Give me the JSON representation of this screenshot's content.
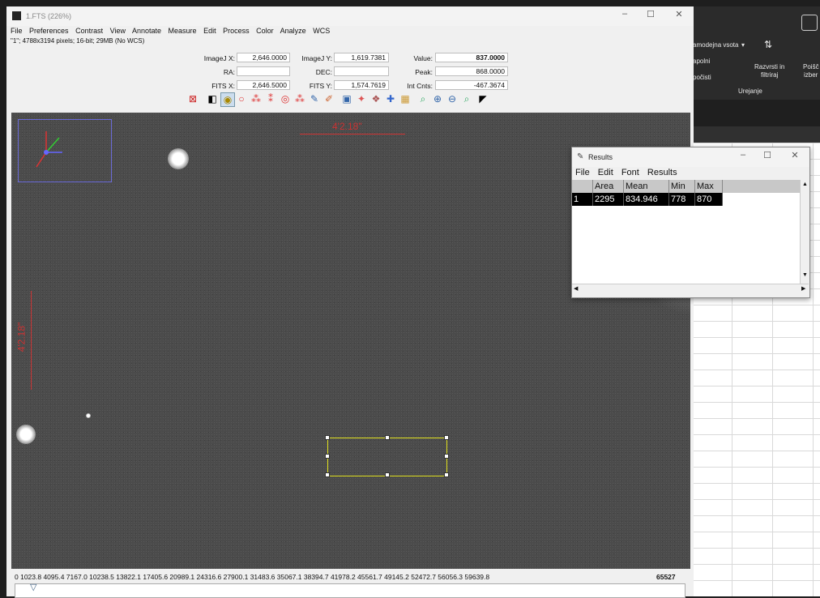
{
  "imagej_window": {
    "title": "1.FTS (226%)",
    "menu": [
      "File",
      "Preferences",
      "Contrast",
      "View",
      "Annotate",
      "Measure",
      "Edit",
      "Process",
      "Color",
      "Analyze",
      "WCS"
    ],
    "info": "\"1\"; 4788x3194 pixels; 16-bit; 29MB (No WCS)",
    "fields": {
      "imagej_x_label": "ImageJ X:",
      "imagej_x": "2,646.0000",
      "imagej_y_label": "ImageJ Y:",
      "imagej_y": "1,619.7381",
      "value_label": "Value:",
      "value": "837.0000",
      "ra_label": "RA:",
      "ra": "",
      "dec_label": "DEC:",
      "dec": "",
      "peak_label": "Peak:",
      "peak": "868.0000",
      "fits_x_label": "FITS X:",
      "fits_x": "2,646.5000",
      "fits_y_label": "FITS Y:",
      "fits_y": "1,574.7619",
      "int_cnts_label": "Int Cnts:",
      "int_cnts": "-467.3674"
    },
    "scale_label_h": "4'2.18\"",
    "scale_label_v": "4'2.18\"",
    "colorbar_ticks": "0  1023.8  4095.4  7167.0  10238.5  13822.1  17405.6  20989.1  24316.6  27900.1  31483.6  35067.1  38394.7  41978.2  45561.7  49145.2  52472.7  56056.3  59639.8",
    "colorbar_max": "65527"
  },
  "results_window": {
    "title": "Results",
    "menu": [
      "File",
      "Edit",
      "Font",
      "Results"
    ],
    "columns": [
      "",
      "Area",
      "Mean",
      "Min",
      "Max"
    ],
    "rows": [
      [
        "1",
        "2295",
        "834.946",
        "778",
        "870"
      ]
    ]
  },
  "excel_background": {
    "r1": "amodejna vsota",
    "r2": "apolni",
    "r3": "počisti",
    "r4": "Razvrsti in",
    "r5": "filtriraj",
    "r6": "Poišč",
    "r7": "izber",
    "r8": "Urejanje"
  }
}
